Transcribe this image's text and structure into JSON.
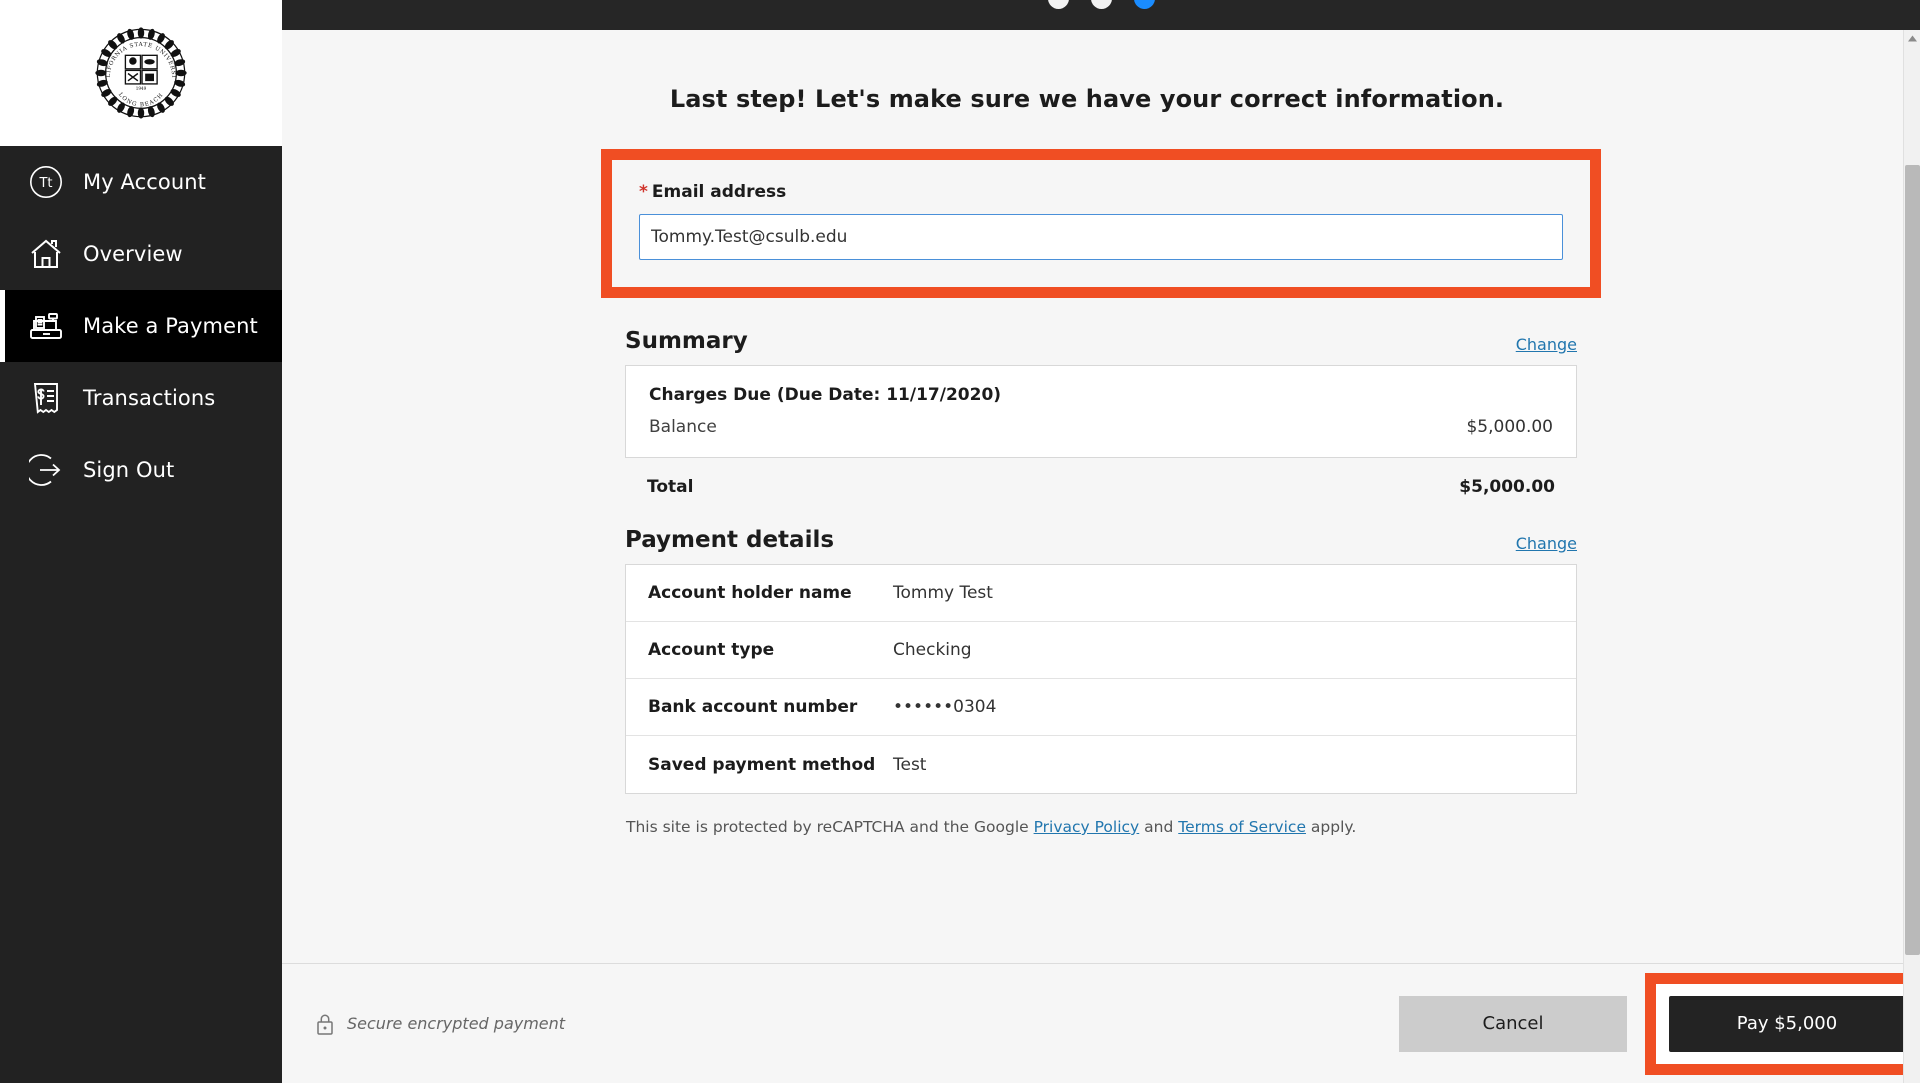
{
  "sidebar": {
    "logo": {
      "name": "csulb-seal",
      "arc_top": "CALIFORNIA STATE UNIVERSITY",
      "arc_bottom": "LONG BEACH",
      "year": "1949"
    },
    "items": [
      {
        "label": "My Account",
        "icon": "avatar-initials-icon",
        "initials": "Tt",
        "active": false
      },
      {
        "label": "Overview",
        "icon": "home-icon",
        "active": false
      },
      {
        "label": "Make a Payment",
        "icon": "cash-register-icon",
        "active": true
      },
      {
        "label": "Transactions",
        "icon": "receipt-icon",
        "active": false
      },
      {
        "label": "Sign Out",
        "icon": "sign-out-icon",
        "active": false
      }
    ]
  },
  "topbar": {
    "steps": [
      {
        "state": "done"
      },
      {
        "state": "done"
      },
      {
        "state": "active"
      }
    ]
  },
  "main": {
    "page_title": "Last step! Let's make sure we have your correct information.",
    "email": {
      "label": "Email address",
      "required_marker": "*",
      "value": "Tommy.Test@csulb.edu",
      "placeholder": "Email address"
    },
    "summary": {
      "title": "Summary",
      "change_label": "Change",
      "charges_title": "Charges Due (Due Date: 11/17/2020)",
      "lines": [
        {
          "label": "Balance",
          "value": "$5,000.00"
        }
      ],
      "total_label": "Total",
      "total_value": "$5,000.00"
    },
    "payment_details": {
      "title": "Payment details",
      "change_label": "Change",
      "rows": [
        {
          "key": "Account holder name",
          "value": "Tommy Test"
        },
        {
          "key": "Account type",
          "value": "Checking"
        },
        {
          "key": "Bank account number",
          "value": "••••••0304"
        },
        {
          "key": "Saved payment method",
          "value": "Test"
        }
      ]
    },
    "recaptcha": {
      "text_before": "This site is protected by reCAPTCHA and the Google ",
      "privacy_link": "Privacy Policy",
      "text_middle": " and ",
      "terms_link": "Terms of Service",
      "text_after": " apply."
    }
  },
  "footer": {
    "secure_text": "Secure encrypted payment",
    "lock_icon": "padlock-icon",
    "cancel_label": "Cancel",
    "pay_label": "Pay $5,000"
  },
  "colors": {
    "highlight_orange": "#F04E23",
    "sidebar_bg": "#222222",
    "sidebar_active_bg": "#000000",
    "accent_link": "#2176ae",
    "step_active": "#1a8cff",
    "pay_button_bg": "#232323",
    "cancel_button_bg": "#cccccc"
  }
}
